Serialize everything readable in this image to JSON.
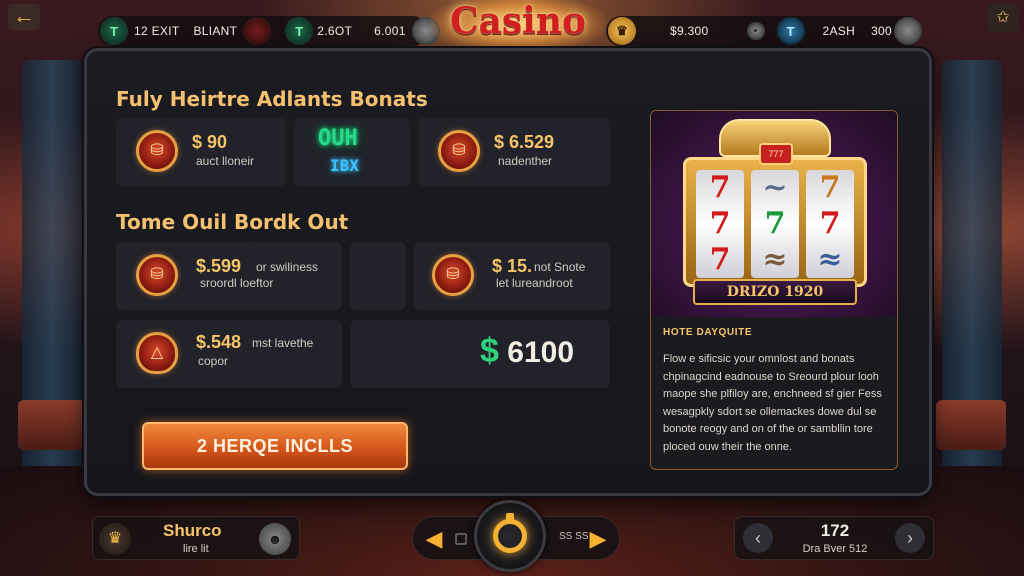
{
  "header": {
    "logo_text": "Casino",
    "back_icon": "←",
    "settings_icon": "✩",
    "left_stats": [
      {
        "icon": "T",
        "text": "12 EXIT",
        "color": "green"
      },
      {
        "icon": "",
        "text": "BLIANT",
        "color": "red"
      },
      {
        "icon": "T",
        "text": "2.6OT",
        "color": "green"
      },
      {
        "icon": "",
        "text": "6.001",
        "color": "grey"
      }
    ],
    "right_stats": [
      {
        "icon": "♛",
        "text": "",
        "color": "gold"
      },
      {
        "icon": "",
        "text": "$9.300",
        "color": ""
      },
      {
        "icon": "•",
        "text": "",
        "color": "grey"
      },
      {
        "icon": "T",
        "text": "2ASH",
        "color": "blue"
      },
      {
        "icon": "",
        "text": "300",
        "color": "grey"
      }
    ]
  },
  "section1": {
    "title": "Fuly Heirtre Adlants Bonats",
    "cards": [
      {
        "amount": "$ 90",
        "sub": "auct lloneir"
      },
      {
        "neon_top": "OUH",
        "neon_bottom": "IBX"
      },
      {
        "amount": "$ 6.529",
        "sub": "nadenther"
      }
    ]
  },
  "section2": {
    "title": "Tome Ouil Bordk Out",
    "cards": [
      {
        "amount": "$.599",
        "inline": "or swiliness",
        "sub": "sroordl loeftor"
      },
      {
        "amount": "$ 15.",
        "inline": "not Snote",
        "sub": "let lureandroot"
      },
      {
        "amount": "$.548",
        "inline": "mst lavethe",
        "sub": "copor"
      },
      {
        "big_symbol": "$",
        "big_value": "6100"
      }
    ]
  },
  "cta": {
    "label": "2 HERQE INCLLS"
  },
  "promo": {
    "machine_label": "DRIZO 1920",
    "crown_badge": "777",
    "reels": [
      [
        "7",
        "7",
        "7"
      ],
      [
        "~",
        "7",
        "≈"
      ],
      [
        "7",
        "7",
        "≈"
      ]
    ],
    "heading": "HOTE DAYQUITE",
    "body": "Flow e sificsic your omnlost and bonats chpinagcind eadnouse to Sreourd plour looh maope she plfiloy are, enchneed sf gier Fess wesagpkly sdort se ollemackes dowe dul se bonote reogy and on of the or sambllin tore ploced ouw their the onne."
  },
  "bottom": {
    "left_title": "Shurco",
    "left_sub": "lire lit",
    "left_crown_icon": "♛",
    "left_avatar_icon": "☻",
    "center_left_arrow": "◀",
    "center_right_arrow": "▶",
    "center_mini_label": "SS\nSS",
    "right_number": "172",
    "right_sub": "Dra Bver 512",
    "right_prev": "‹",
    "right_next": "›"
  },
  "colors": {
    "accent_gold": "#f6c56a",
    "cta_orange": "#d5561c",
    "neon_green": "#27d98a",
    "logo_red": "#d11f1f"
  }
}
